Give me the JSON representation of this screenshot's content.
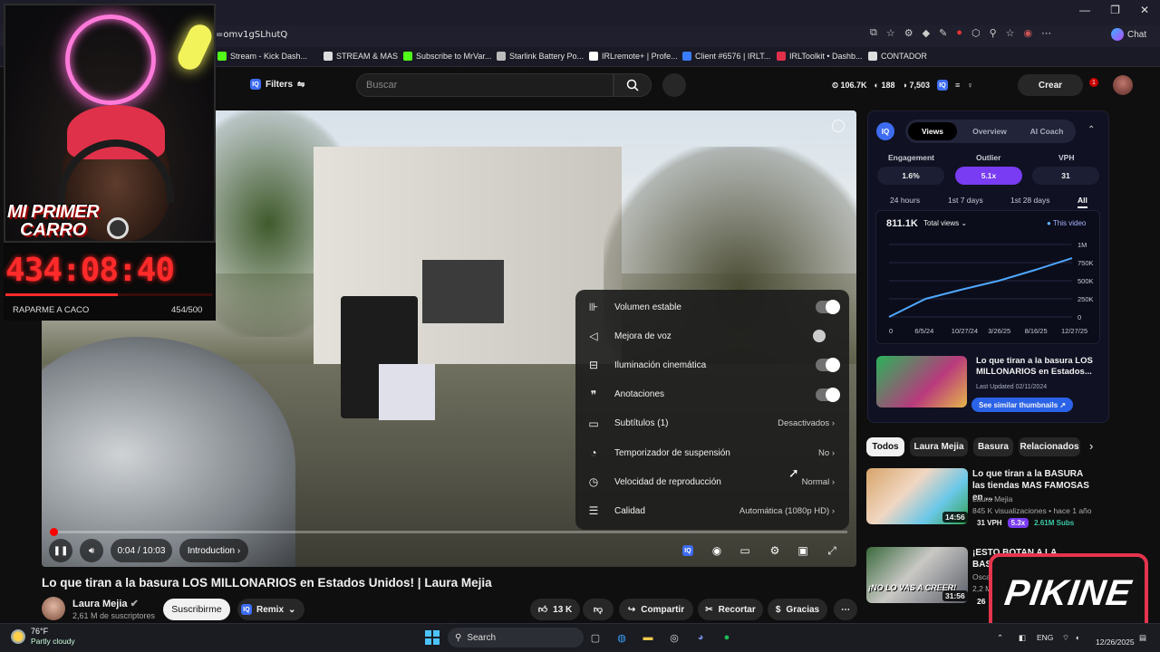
{
  "browser": {
    "url": "=omv1gSLhutQ",
    "chat_label": "Chat",
    "bookmarks": [
      {
        "label": "Stream - Kick Dash...",
        "color": "#53fc18"
      },
      {
        "label": "STREAM & MAS",
        "color": "#dddddd"
      },
      {
        "label": "Subscribe to MrVar...",
        "color": "#53fc18"
      },
      {
        "label": "Starlink Battery Po...",
        "color": "#bbbbbb"
      },
      {
        "label": "IRLremote+ | Profe...",
        "color": "#ffffff"
      },
      {
        "label": "Client #6576 | IRLT...",
        "color": "#3b7cff"
      },
      {
        "label": "IRLToolkit • Dashb...",
        "color": "#e0304a"
      },
      {
        "label": "CONTADOR",
        "color": "#dddddd"
      }
    ]
  },
  "header": {
    "filters_label": "Filters",
    "search_placeholder": "Buscar",
    "stats": {
      "views": "106.7K",
      "likes": "188",
      "comments": "7,503"
    },
    "create_label": "Crear",
    "notif_count": "1"
  },
  "player": {
    "time": "0:04 / 10:03",
    "chapter": "Introduction",
    "progress_fraction": 0.004,
    "settings": [
      {
        "icon": "volume-stable-icon",
        "label": "Volumen estable",
        "type": "toggle",
        "on": true
      },
      {
        "icon": "voice-boost-icon",
        "label": "Mejora de voz",
        "type": "toggle",
        "on": false
      },
      {
        "icon": "ambient-mode-icon",
        "label": "Iluminación cinemática",
        "type": "toggle",
        "on": true
      },
      {
        "icon": "annotations-icon",
        "label": "Anotaciones",
        "type": "toggle",
        "on": true
      },
      {
        "icon": "subtitles-icon",
        "label": "Subtítulos (1)",
        "type": "value",
        "value": "Desactivados"
      },
      {
        "icon": "sleep-timer-icon",
        "label": "Temporizador de suspensión",
        "type": "value",
        "value": "No"
      },
      {
        "icon": "playback-speed-icon",
        "label": "Velocidad de reproducción",
        "type": "value",
        "value": "Normal"
      },
      {
        "icon": "quality-icon",
        "label": "Calidad",
        "type": "value",
        "value": "Automática (1080p HD)"
      }
    ]
  },
  "video": {
    "title": "Lo que tiran a la basura LOS MILLONARIOS en Estados Unidos! | Laura Mejia",
    "channel": "Laura Mejia",
    "subscribers": "2,61 M de suscriptores",
    "subscribe_label": "Suscribirme",
    "remix_label": "Remix",
    "likes": "13 K",
    "share_label": "Compartir",
    "clip_label": "Recortar",
    "thanks_label": "Gracias"
  },
  "vidiq": {
    "tabs": [
      "Views",
      "Overview",
      "AI Coach"
    ],
    "active_tab": "Views",
    "metrics": [
      {
        "label": "Engagement",
        "value": "1.6%"
      },
      {
        "label": "Outlier",
        "value": "5.1x"
      },
      {
        "label": "VPH",
        "value": "31"
      }
    ],
    "periods": [
      "24 hours",
      "1st 7 days",
      "1st 28 days",
      "All"
    ],
    "active_period": "All",
    "total": "811.1K",
    "total_select": "Total views",
    "legend": "This video",
    "video_title": "Lo que tiran a la basura LOS MILLONARIOS en Estados...",
    "last_updated": "Last Updated 02/11/2024",
    "similar_label": "See similar thumbnails"
  },
  "chart_data": {
    "type": "line",
    "x": [
      "0",
      "6/5/24",
      "10/27/24",
      "3/26/25",
      "8/16/25",
      "12/27/25"
    ],
    "yticks": [
      "0",
      "250K",
      "500K",
      "750K",
      "1M"
    ],
    "ylim": [
      0,
      1000000
    ],
    "series": [
      {
        "name": "This video",
        "values": [
          0,
          250000,
          380000,
          500000,
          650000,
          811100
        ]
      }
    ],
    "grid": true,
    "legend": "top-right"
  },
  "chips": [
    "Todos",
    "Laura Mejia",
    "Basura",
    "Relacionados"
  ],
  "recommendations": [
    {
      "title": "Lo que tiran a la BASURA las tiendas MAS FAMOSAS en ...",
      "channel": "Laura Mejia",
      "meta": "845 K visualizaciones • hace 1 año",
      "duration": "14:56",
      "vph": "31 VPH",
      "outlier": "5.3x",
      "subs": "2.61M Subs"
    },
    {
      "title": "¡ESTO BOTAN A LA BASURA EN EST...",
      "channel": "Osca...",
      "meta": "2,2 M",
      "duration": "31:56",
      "thumb_text": "¡NO LO VAS A CREER!",
      "vph": "26"
    }
  ],
  "overlay": {
    "title_line1": "MI PRIMER",
    "title_line2": "CARRO",
    "timer": "434:08:40",
    "goal_label": "RAPARME A CACO",
    "goal_count": "454/500",
    "goal_fraction": 0.908,
    "brand": "PIKINE"
  },
  "taskbar": {
    "temp": "76°F",
    "condition": "Partly cloudy",
    "search_label": "Search",
    "lang": "ENG",
    "date": "12/26/2025"
  }
}
